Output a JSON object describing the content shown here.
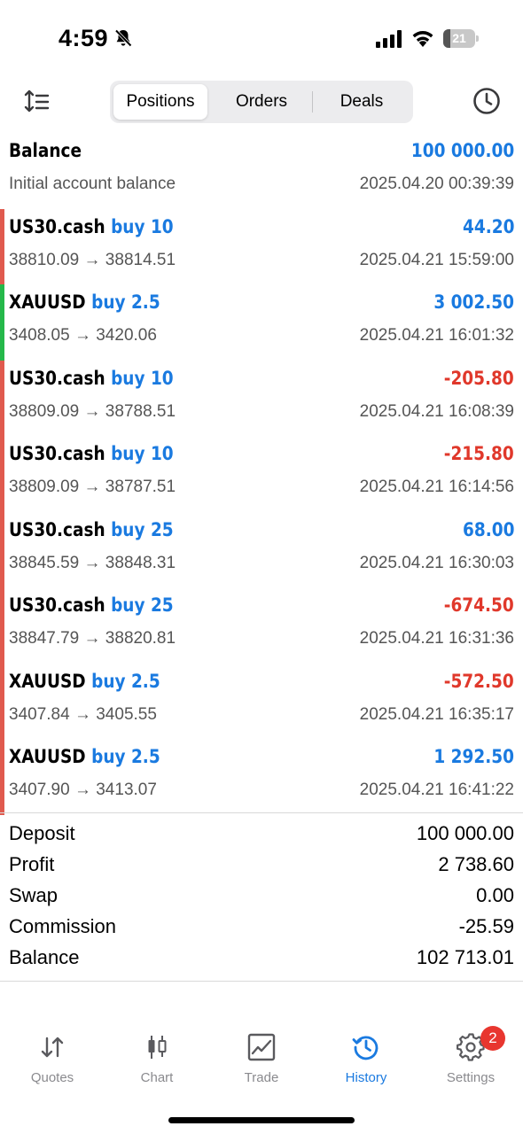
{
  "status_bar": {
    "time": "4:59",
    "battery": "21",
    "battery_level": 0.21
  },
  "toolbar": {
    "tabs": [
      {
        "label": "Positions",
        "active": true
      },
      {
        "label": "Orders",
        "active": false
      },
      {
        "label": "Deals",
        "active": false
      }
    ]
  },
  "balance_entry": {
    "title": "Balance",
    "amount": "100 000.00",
    "subtitle": "Initial account balance",
    "date": "2025.04.20 00:39:39"
  },
  "deals": [
    {
      "symbol": "US30.cash",
      "side": "buy 10",
      "amount": "44.20",
      "prices": "38810.09 → 38814.51",
      "date": "2025.04.21 15:59:00",
      "indicator": "#e05a4e",
      "sign": "pos"
    },
    {
      "symbol": "XAUUSD",
      "side": "buy 2.5",
      "amount": "3 002.50",
      "prices": "3408.05 → 3420.06",
      "date": "2025.04.21 16:01:32",
      "indicator": "#25b84a",
      "sign": "pos"
    },
    {
      "symbol": "US30.cash",
      "side": "buy 10",
      "amount": "-205.80",
      "prices": "38809.09 → 38788.51",
      "date": "2025.04.21 16:08:39",
      "indicator": "#e05a4e",
      "sign": "neg"
    },
    {
      "symbol": "US30.cash",
      "side": "buy 10",
      "amount": "-215.80",
      "prices": "38809.09 → 38787.51",
      "date": "2025.04.21 16:14:56",
      "indicator": "#e05a4e",
      "sign": "neg"
    },
    {
      "symbol": "US30.cash",
      "side": "buy 25",
      "amount": "68.00",
      "prices": "38845.59 → 38848.31",
      "date": "2025.04.21 16:30:03",
      "indicator": "#e05a4e",
      "sign": "pos"
    },
    {
      "symbol": "US30.cash",
      "side": "buy 25",
      "amount": "-674.50",
      "prices": "38847.79 → 38820.81",
      "date": "2025.04.21 16:31:36",
      "indicator": "#e05a4e",
      "sign": "neg"
    },
    {
      "symbol": "XAUUSD",
      "side": "buy 2.5",
      "amount": "-572.50",
      "prices": "3407.84 → 3405.55",
      "date": "2025.04.21 16:35:17",
      "indicator": "#e05a4e",
      "sign": "neg"
    },
    {
      "symbol": "XAUUSD",
      "side": "buy 2.5",
      "amount": "1 292.50",
      "prices": "3407.90 → 3413.07",
      "date": "2025.04.21 16:41:22",
      "indicator": "#e05a4e",
      "sign": "pos"
    }
  ],
  "summary": [
    {
      "label": "Deposit",
      "value": "100 000.00"
    },
    {
      "label": "Profit",
      "value": "2 738.60"
    },
    {
      "label": "Swap",
      "value": "0.00"
    },
    {
      "label": "Commission",
      "value": "-25.59"
    },
    {
      "label": "Balance",
      "value": "102 713.01"
    }
  ],
  "tabbar": {
    "items": [
      {
        "label": "Quotes",
        "icon": "quotes-arrows-icon"
      },
      {
        "label": "Chart",
        "icon": "candlestick-icon"
      },
      {
        "label": "Trade",
        "icon": "trade-chart-icon"
      },
      {
        "label": "History",
        "icon": "history-clock-icon",
        "active": true
      },
      {
        "label": "Settings",
        "icon": "gear-icon",
        "badge": "2"
      }
    ]
  },
  "colors": {
    "accent": "#1a7ae0",
    "negative": "#e0382b",
    "loss_indicator": "#e05a4e",
    "profit_indicator": "#25b84a"
  }
}
